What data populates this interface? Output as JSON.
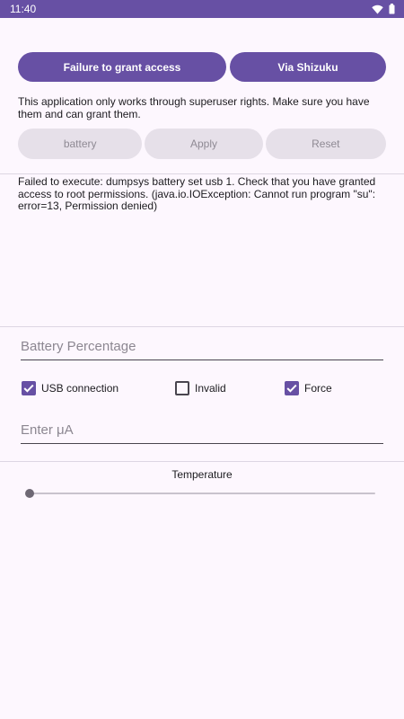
{
  "status_bar": {
    "time": "11:40",
    "icons": [
      "wifi-icon",
      "battery-icon"
    ]
  },
  "buttons": {
    "grant_access": "Failure to grant access",
    "via_shizuku": "Via Shizuku",
    "battery": "battery",
    "apply": "Apply",
    "reset": "Reset"
  },
  "info_text": "This application only works through superuser rights. Make sure you have them and can grant them.",
  "error_text": "Failed to execute: dumpsys battery set usb 1. Check that you have granted access to root permissions. (java.io.IOException: Cannot run program \"su\": error=13, Permission denied)",
  "fields": {
    "battery_percentage": {
      "placeholder": "Battery Percentage",
      "value": ""
    },
    "current": {
      "placeholder": "Enter μA",
      "value": ""
    }
  },
  "checkboxes": {
    "usb_connection": {
      "label": "USB connection",
      "checked": true
    },
    "invalid": {
      "label": "Invalid",
      "checked": false
    },
    "force": {
      "label": "Force",
      "checked": true
    }
  },
  "temperature": {
    "label": "Temperature",
    "level": 0
  },
  "colors": {
    "primary": "#6750a4",
    "background": "#fdf7fe",
    "disabled_bg": "#e6e0e9",
    "disabled_text": "#8f8a94"
  }
}
